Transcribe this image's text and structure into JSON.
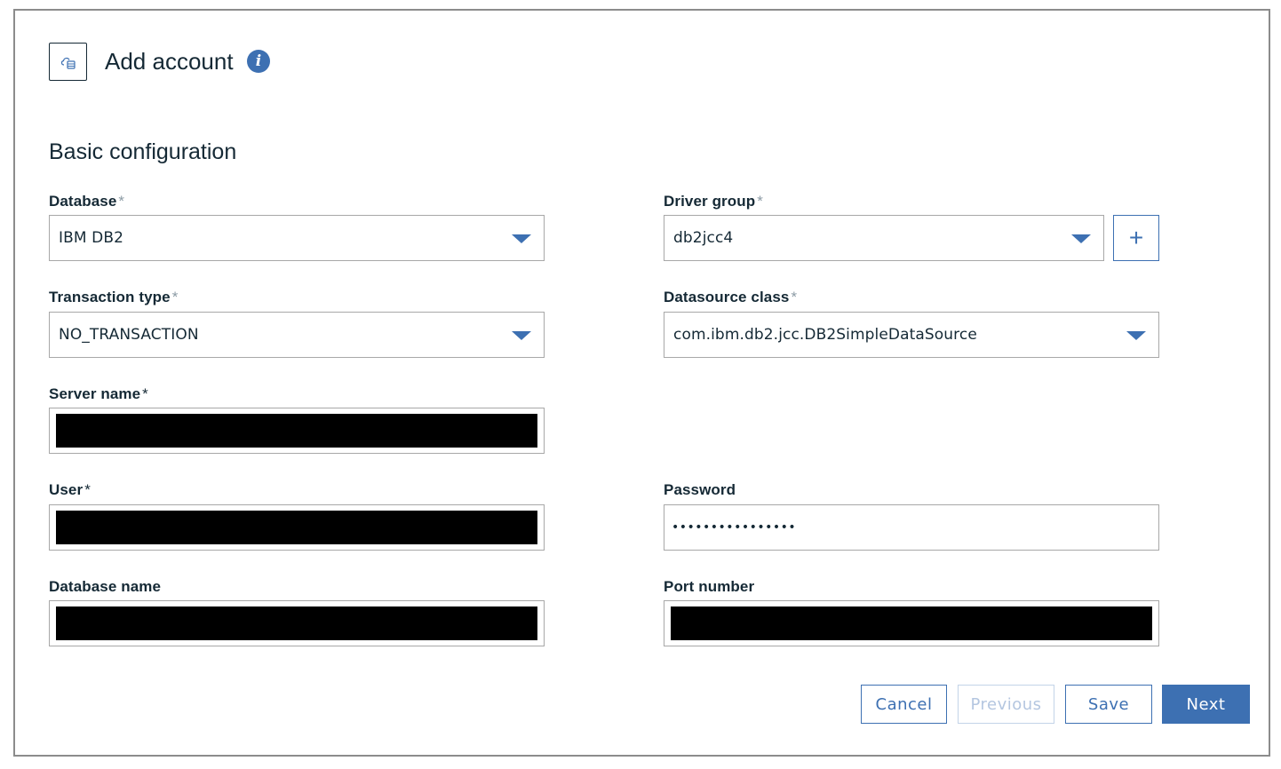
{
  "header": {
    "title": "Add account",
    "icon": "cloud-database-icon",
    "info_icon": "info-icon",
    "info_glyph": "i"
  },
  "section": {
    "title": "Basic configuration"
  },
  "required_marker": "*",
  "fields": {
    "database": {
      "label": "Database",
      "value": "IBM DB2"
    },
    "driver_group": {
      "label": "Driver group",
      "value": "db2jcc4",
      "add_label": "+"
    },
    "transaction_type": {
      "label": "Transaction type",
      "value": "NO_TRANSACTION"
    },
    "datasource_class": {
      "label": "Datasource class",
      "value": "com.ibm.db2.jcc.DB2SimpleDataSource"
    },
    "server_name": {
      "label": "Server name"
    },
    "user": {
      "label": "User"
    },
    "password": {
      "label": "Password",
      "value": "••••••••••••••••"
    },
    "database_name": {
      "label": "Database name"
    },
    "port_number": {
      "label": "Port number"
    }
  },
  "buttons": {
    "cancel": "Cancel",
    "previous": "Previous",
    "save": "Save",
    "next": "Next"
  },
  "colors": {
    "accent": "#3d70b2",
    "text": "#152935",
    "required_muted": "#8c9ba5"
  }
}
